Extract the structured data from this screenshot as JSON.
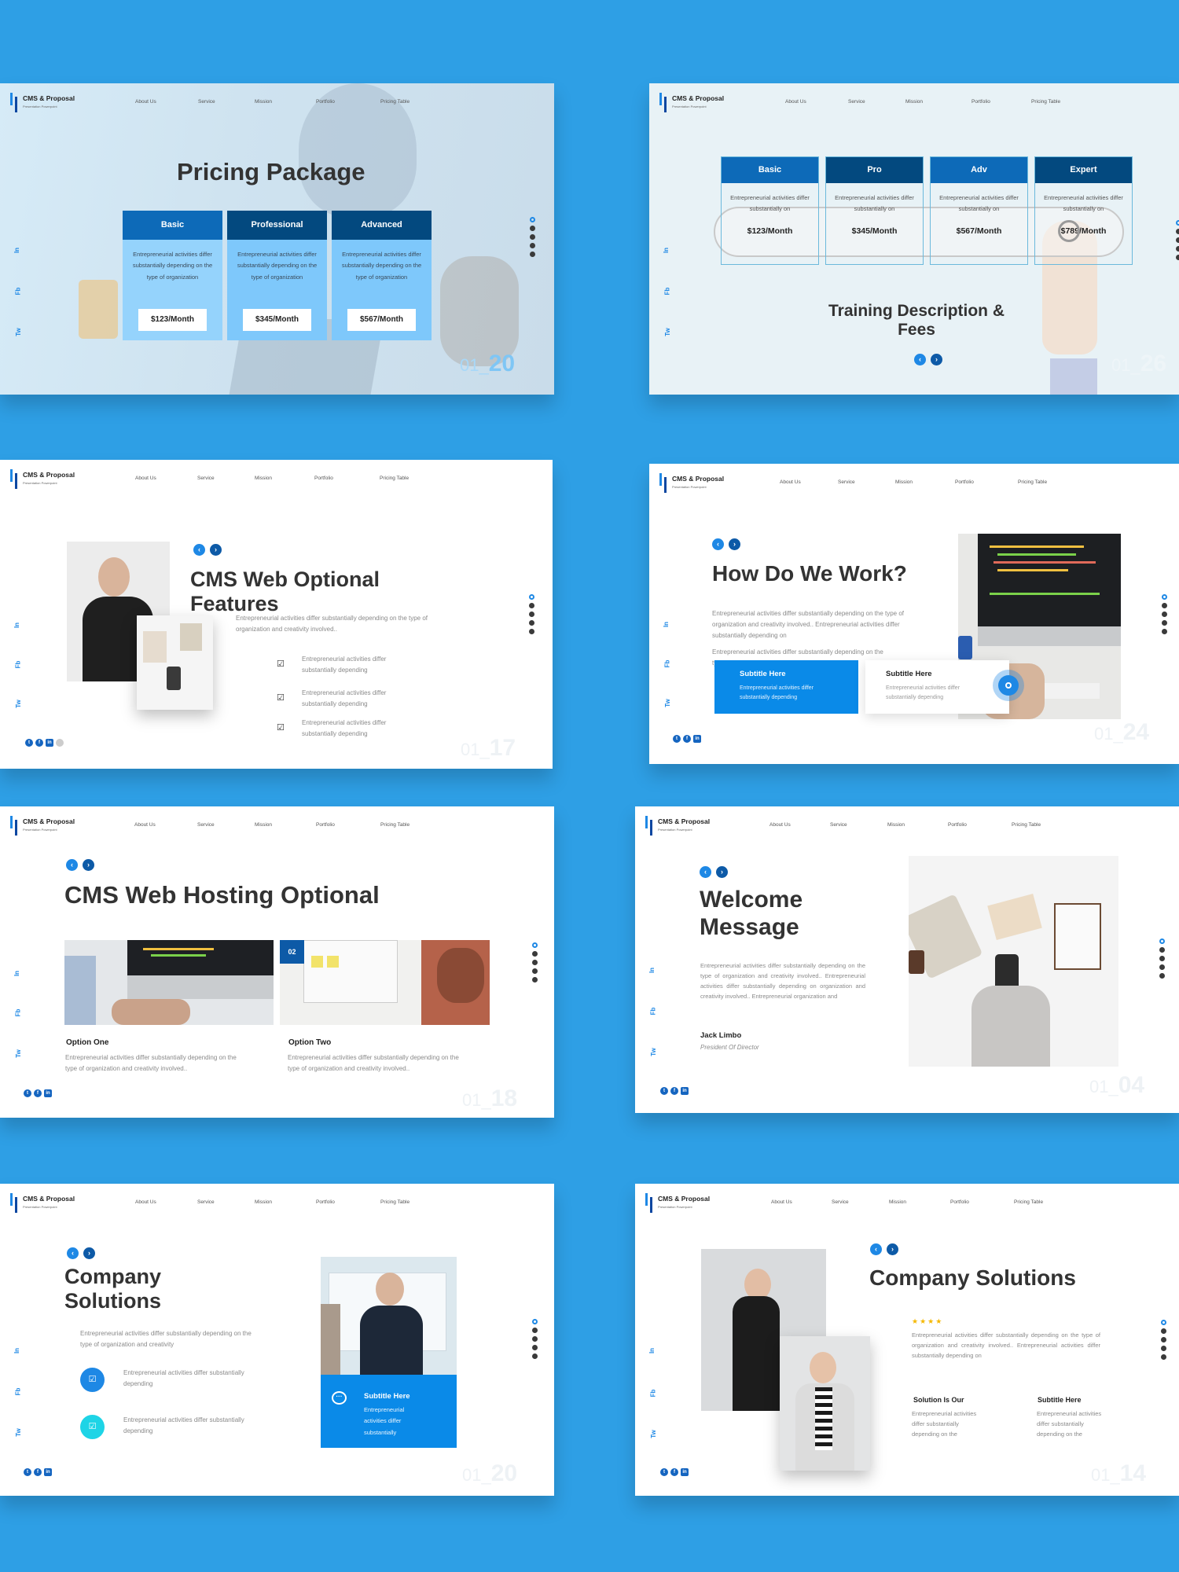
{
  "colors": {
    "background": "#2e9fe5",
    "accent_blue": "#1e88e5",
    "dark_blue": "#0d5aa7",
    "navy": "#03497f",
    "cyan": "#1ed4e6",
    "star": "#f5b800"
  },
  "header": {
    "logo_title": "CMS & Proposal",
    "logo_subtitle": "Presentation Powerpoint",
    "nav": [
      "About Us",
      "Service",
      "Mission",
      "Portfolio",
      "Pricing Table"
    ]
  },
  "social_vertical": [
    "In",
    "Fb",
    "Tw"
  ],
  "social_icons": [
    "twitter-icon",
    "facebook-icon",
    "linkedin-icon"
  ],
  "slides": {
    "s1": {
      "title": "Pricing Package",
      "page_prefix": "01_",
      "page_num": "20",
      "plans": [
        {
          "name": "Basic",
          "desc": "Entrepreneurial activities differ substantially depending on the type of organization",
          "price": "$123/Month"
        },
        {
          "name": "Professional",
          "desc": "Entrepreneurial activities differ substantially depending on the type of organization",
          "price": "$345/Month"
        },
        {
          "name": "Advanced",
          "desc": "Entrepreneurial activities differ substantially depending on the type of organization",
          "price": "$567/Month"
        }
      ]
    },
    "s2": {
      "title_line1": "Training Description &",
      "title_line2": "Fees",
      "page_prefix": "01_",
      "page_num": "26",
      "plans": [
        {
          "name": "Basic",
          "desc": "Entrepreneurial activities differ substantially on",
          "price": "$123/Month"
        },
        {
          "name": "Pro",
          "desc": "Entrepreneurial activities differ substantially on",
          "price": "$345/Month"
        },
        {
          "name": "Adv",
          "desc": "Entrepreneurial activities differ substantially on",
          "price": "$567/Month"
        },
        {
          "name": "Expert",
          "desc": "Entrepreneurial activities differ substantially on",
          "price": "$789/Month"
        }
      ]
    },
    "s3": {
      "title_line1": "CMS Web Optional",
      "title_line2": "Features",
      "intro": "Entrepreneurial activities differ substantially depending on the type of organization and creativity involved..",
      "checklist": [
        "Entrepreneurial activities differ substantially depending",
        "Entrepreneurial activities differ substantially depending",
        "Entrepreneurial activities differ substantially depending"
      ],
      "page_prefix": "01_",
      "page_num": "17"
    },
    "s4": {
      "title": "How Do We Work?",
      "para1": "Entrepreneurial activities differ substantially depending on the type of organization and creativity involved.. Entrepreneurial activities differ substantially depending on",
      "para2": "Entrepreneurial activities differ substantially depending on the type of organization and creativity involved..",
      "card1_title": "Subtitle Here",
      "card1_text": "Entrepreneurial activities differ substantially depending",
      "card2_title": "Subtitle Here",
      "card2_text": "Entrepreneurial activities differ substantially depending",
      "page_prefix": "01_",
      "page_num": "24"
    },
    "s5": {
      "title": "CMS Web Hosting Optional",
      "badge": "02",
      "option1_title": "Option One",
      "option1_text": "Entrepreneurial activities differ substantially depending on the type of organization and creativity involved..",
      "option2_title": "Option Two",
      "option2_text": "Entrepreneurial activities differ substantially depending on the type of organization and creativity involved..",
      "page_prefix": "01_",
      "page_num": "18"
    },
    "s6": {
      "title_line1": "Welcome",
      "title_line2": "Message",
      "body": "Entrepreneurial activities differ substantially depending on the type of organization and creativity involved.. Entrepreneurial activities differ substantially depending on organization and creativity involved.. Entrepreneurial organization and",
      "name": "Jack Limbo",
      "role": "President Of Director",
      "page_prefix": "01_",
      "page_num": "04"
    },
    "s7": {
      "title_line1": "Company",
      "title_line2": "Solutions",
      "intro": "Entrepreneurial activities differ substantially depending on the type of organization and creativity",
      "items": [
        "Entrepreneurial activities differ substantially depending",
        "Entrepreneurial activities differ substantially depending"
      ],
      "card_title": "Subtitle Here",
      "card_text": "Entrepreneurial activities differ substantially",
      "page_prefix": "01_",
      "page_num": "20"
    },
    "s8": {
      "title": "Company Solutions",
      "rating": 4,
      "intro": "Entrepreneurial activities differ substantially depending on the type of organization and creativity involved.. Entrepreneurial activities differ substantially depending on",
      "col1_title": "Solution Is Our",
      "col1_text": "Entrepreneurial activities differ substantially depending on the",
      "col2_title": "Subtitle Here",
      "col2_text": "Entrepreneurial activities differ substantially depending on the",
      "page_prefix": "01_",
      "page_num": "14"
    }
  }
}
